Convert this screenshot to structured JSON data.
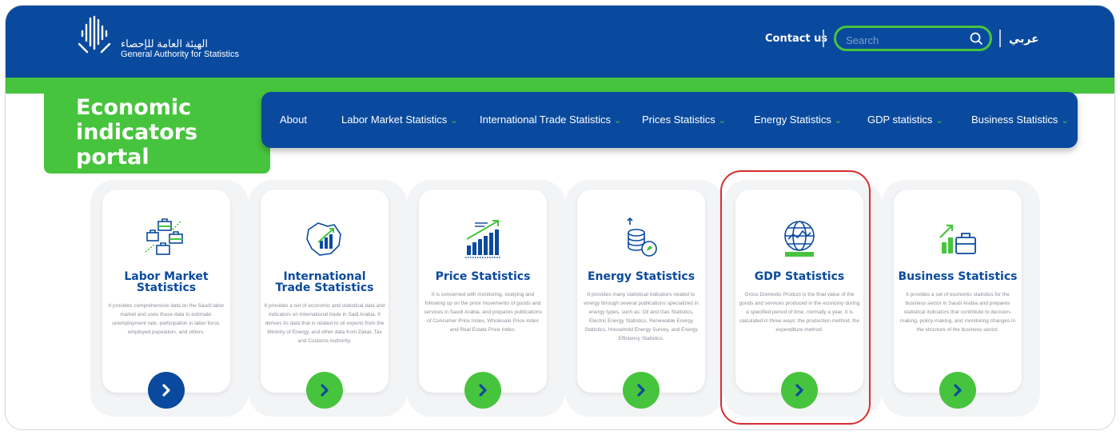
{
  "header": {
    "logo_ar": "الهيئة العامة للإحصاء",
    "logo_en": "General Authority for Statistics",
    "contact_label": "Contact us",
    "search_placeholder": "Search",
    "lang_label": "عربي"
  },
  "portal": {
    "title": "Economic indicators portal"
  },
  "nav": {
    "items": [
      {
        "label": "About",
        "has_dropdown": false
      },
      {
        "label": "Labor Market Statistics",
        "has_dropdown": true
      },
      {
        "label": "International Trade Statistics",
        "has_dropdown": true
      },
      {
        "label": "Prices Statistics",
        "has_dropdown": true
      },
      {
        "label": "Energy Statistics",
        "has_dropdown": true
      },
      {
        "label": "GDP statistics",
        "has_dropdown": true
      },
      {
        "label": "Business Statistics",
        "has_dropdown": true
      }
    ]
  },
  "cards": [
    {
      "icon": "labor-market-icon",
      "title": "Labor Market Statistics",
      "description": "It provides comprehensive data on the Saudi labor market and uses these data to estimate: unemployment rate, participation in labor force, employed population, and others.",
      "button_color": "#0a4a9e"
    },
    {
      "icon": "international-trade-icon",
      "title": "International Trade Statistics",
      "description": "It provides a set of economic and statistical data and indicators on international trade in Sadi Arabia. It derives its data that is related to oil exports from the Ministry of Energy, and other data from Zakat, Tax and Customs Authority.",
      "button_color": "#47c43d"
    },
    {
      "icon": "price-statistics-icon",
      "title": "Price Statistics",
      "description": "It is concerned with monitoring, studying and following up on the price movements of goods and services in Saudi Arabia, and prepares publications of Consumer Price Index, Wholesale Price Index and Real Estate Price Index.",
      "button_color": "#47c43d"
    },
    {
      "icon": "energy-statistics-icon",
      "title": "Energy Statistics",
      "description": "It provides many statistical indicators related to energy through several publications specialized in energy types, such as: Oil and Gas Statistics, Electric Energy Statistics, Renewable Energy Statistics, Household Energy Survey, and Energy Efficiency Statistics.",
      "button_color": "#47c43d"
    },
    {
      "icon": "gdp-globe-icon",
      "title": "GDP Statistics",
      "description": "Gross Domestic Product is the final value of the goods and services produced in the economy during a specified period of time, normally a year. It is calculated in three ways: the production method, the expenditure method.",
      "button_color": "#47c43d"
    },
    {
      "icon": "business-statistics-icon",
      "title": "Business Statistics",
      "description": "It provides a set of economic statistics for the business sector in Saudi Arabia and prepares statistical indicators that contribute to decision-making, policy-making, and monitoring changes in the structure of the business sector.",
      "button_color": "#47c43d"
    }
  ],
  "colors": {
    "brand_blue": "#0a4a9e",
    "brand_green": "#47c43d",
    "highlight_red": "#d62f2f"
  }
}
